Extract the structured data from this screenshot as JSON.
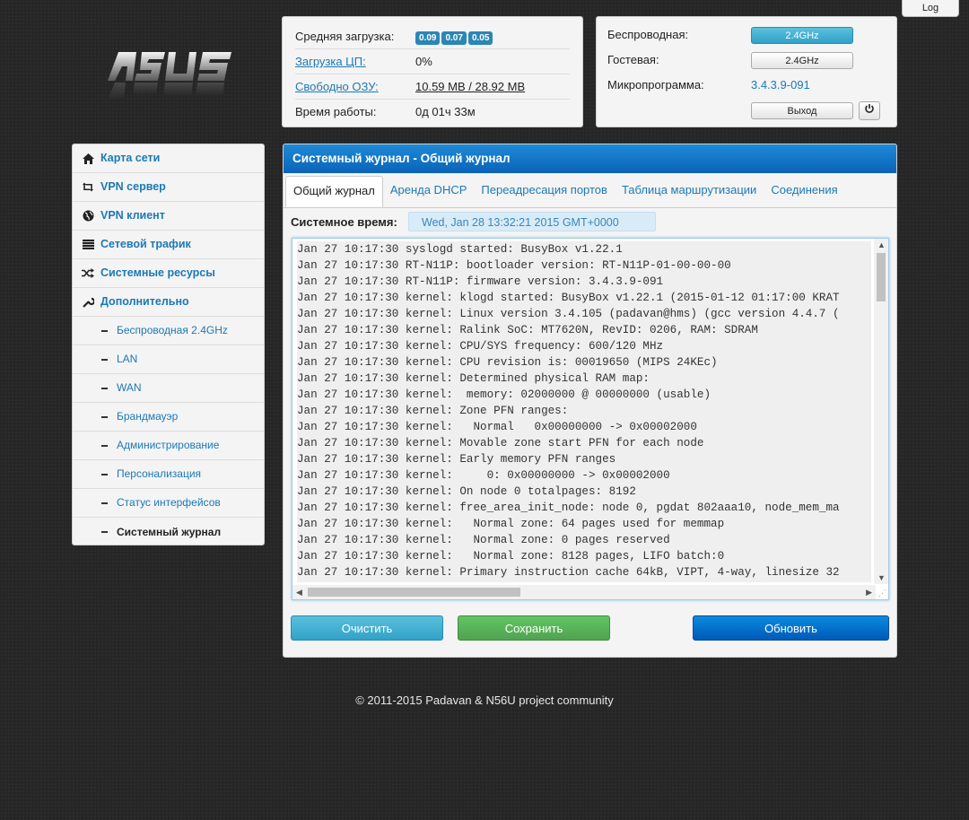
{
  "top": {
    "log_button": "Log"
  },
  "logo": {
    "alt": "ASUS logo"
  },
  "status": {
    "load_label": "Средняя загрузка:",
    "load_values": [
      "0.09",
      "0.07",
      "0.05"
    ],
    "cpu_label": "Загрузка ЦП:",
    "cpu_value": "0%",
    "ram_label": "Свободно ОЗУ:",
    "ram_value": "10.59 MB / 28.92 MB",
    "uptime_label": "Время работы:",
    "uptime_value": "0д 01ч 33м"
  },
  "wireless": {
    "wireless_label": "Беспроводная:",
    "wireless_button": "2.4GHz",
    "guest_label": "Гостевая:",
    "guest_button": "2.4GHz",
    "firmware_label": "Микропрограмма:",
    "firmware_value": "3.4.3.9-091",
    "logout_button": "Выход"
  },
  "sidebar": {
    "items": [
      {
        "label": "Карта сети",
        "icon": "home-icon"
      },
      {
        "label": "VPN сервер",
        "icon": "retweet-icon"
      },
      {
        "label": "VPN клиент",
        "icon": "globe-icon"
      },
      {
        "label": "Сетевой трафик",
        "icon": "list-icon"
      },
      {
        "label": "Системные ресурсы",
        "icon": "random-icon"
      },
      {
        "label": "Дополнительно",
        "icon": "wrench-icon"
      }
    ],
    "subitems": [
      "Беспроводная 2.4GHz",
      "LAN",
      "WAN",
      "Брандмауэр",
      "Администрирование",
      "Персонализация",
      "Статус интерфейсов",
      "Системный журнал"
    ]
  },
  "main": {
    "title": "Системный журнал - Общий журнал",
    "tabs": [
      "Общий журнал",
      "Аренда DHCP",
      "Переадресация портов",
      "Таблица маршрутизации",
      "Соединения"
    ],
    "systime_label": "Системное время:",
    "systime_value": "Wed, Jan 28 13:32:21 2015 GMT+0000",
    "log_lines": [
      "Jan 27 10:17:30 syslogd started: BusyBox v1.22.1",
      "Jan 27 10:17:30 RT-N11P: bootloader version: RT-N11P-01-00-00-00",
      "Jan 27 10:17:30 RT-N11P: firmware version: 3.4.3.9-091",
      "Jan 27 10:17:30 kernel: klogd started: BusyBox v1.22.1 (2015-01-12 01:17:00 KRAT",
      "Jan 27 10:17:30 kernel: Linux version 3.4.105 (padavan@hms) (gcc version 4.4.7 (",
      "Jan 27 10:17:30 kernel: Ralink SoC: MT7620N, RevID: 0206, RAM: SDRAM",
      "Jan 27 10:17:30 kernel: CPU/SYS frequency: 600/120 MHz",
      "Jan 27 10:17:30 kernel: CPU revision is: 00019650 (MIPS 24KEc)",
      "Jan 27 10:17:30 kernel: Determined physical RAM map:",
      "Jan 27 10:17:30 kernel:  memory: 02000000 @ 00000000 (usable)",
      "Jan 27 10:17:30 kernel: Zone PFN ranges:",
      "Jan 27 10:17:30 kernel:   Normal   0x00000000 -> 0x00002000",
      "Jan 27 10:17:30 kernel: Movable zone start PFN for each node",
      "Jan 27 10:17:30 kernel: Early memory PFN ranges",
      "Jan 27 10:17:30 kernel:     0: 0x00000000 -> 0x00002000",
      "Jan 27 10:17:30 kernel: On node 0 totalpages: 8192",
      "Jan 27 10:17:30 kernel: free_area_init_node: node 0, pgdat 802aaa10, node_mem_ma",
      "Jan 27 10:17:30 kernel:   Normal zone: 64 pages used for memmap",
      "Jan 27 10:17:30 kernel:   Normal zone: 0 pages reserved",
      "Jan 27 10:17:30 kernel:   Normal zone: 8128 pages, LIFO batch:0",
      "Jan 27 10:17:30 kernel: Primary instruction cache 64kB, VIPT, 4-way, linesize 32"
    ],
    "clear_button": "Очистить",
    "save_button": "Сохранить",
    "refresh_button": "Обновить"
  },
  "footer": {
    "text": "© 2011-2015 Padavan & N56U project community"
  },
  "colors": {
    "link": "#1c79b5",
    "header_blue": "#0a63b8",
    "info_button": "#31a2c8",
    "success_button": "#51a351",
    "primary_button": "#0059b8"
  }
}
